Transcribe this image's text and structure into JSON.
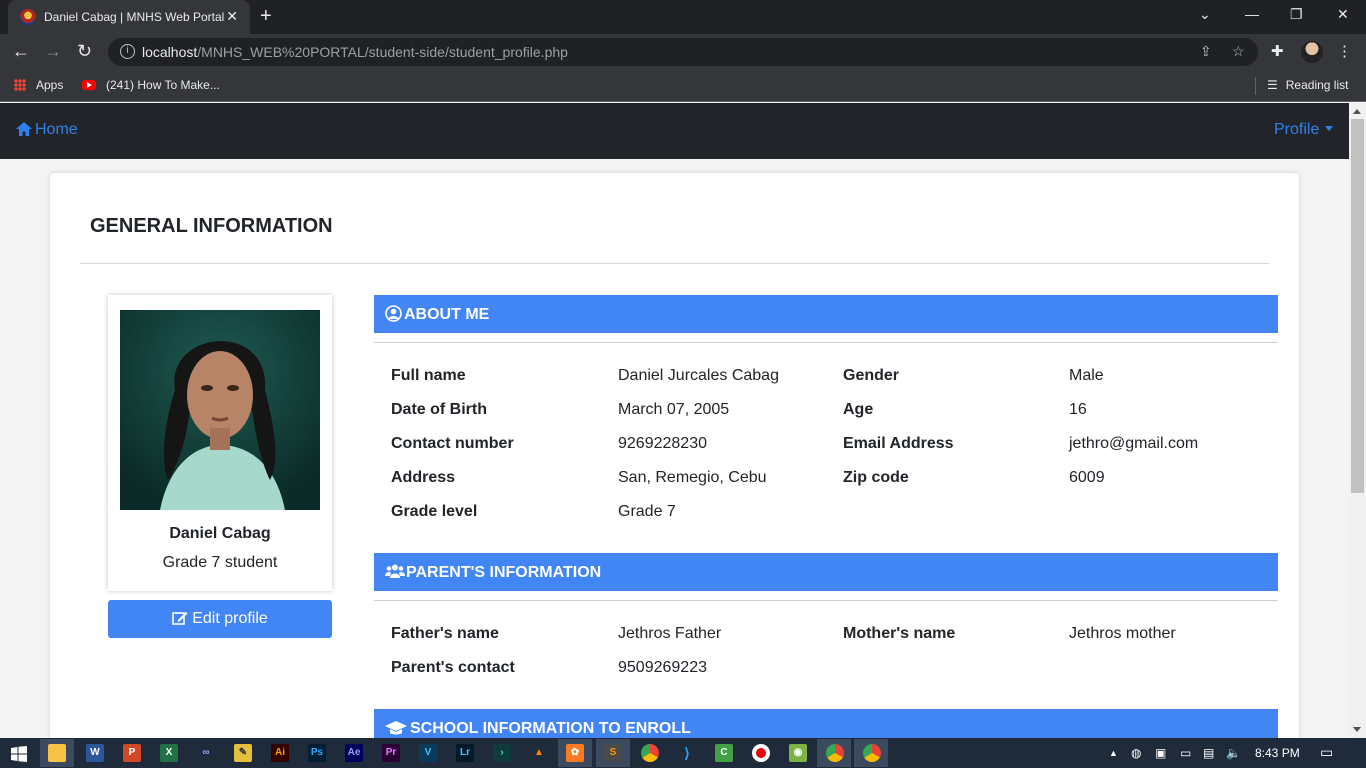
{
  "browser": {
    "tab_title": "Daniel Cabag | MNHS Web Portal",
    "url_host": "localhost",
    "url_path": "/MNHS_WEB%20PORTAL/student-side/student_profile.php",
    "bookmarks": [
      {
        "label": "Apps",
        "icon": "apps-grid-icon"
      },
      {
        "label": "(241) How To Make...",
        "icon": "youtube-icon"
      }
    ],
    "reading_list": "Reading list"
  },
  "nav": {
    "home_label": "Home",
    "profile_label": "Profile"
  },
  "page": {
    "title": "GENERAL INFORMATION"
  },
  "profile_card": {
    "name": "Daniel Cabag",
    "subtitle": "Grade 7 student",
    "edit_label": "Edit profile"
  },
  "about": {
    "heading": "ABOUT ME",
    "fields": [
      {
        "label": "Full name",
        "value": "Daniel Jurcales Cabag"
      },
      {
        "label": "Gender",
        "value": "Male"
      },
      {
        "label": "Date of Birth",
        "value": "March 07, 2005"
      },
      {
        "label": "Age",
        "value": "16"
      },
      {
        "label": "Contact number",
        "value": "9269228230"
      },
      {
        "label": "Email Address",
        "value": "jethro@gmail.com"
      },
      {
        "label": "Address",
        "value": "San, Remegio, Cebu"
      },
      {
        "label": "Zip code",
        "value": "6009"
      },
      {
        "label": "Grade level",
        "value": "Grade 7"
      }
    ]
  },
  "parents": {
    "heading": "PARENT'S INFORMATION",
    "fields": [
      {
        "label": "Father's name",
        "value": "Jethros Father"
      },
      {
        "label": "Mother's name",
        "value": "Jethros mother"
      },
      {
        "label": "Parent's contact",
        "value": "9509269223"
      }
    ]
  },
  "school": {
    "heading": "SCHOOL INFORMATION TO ENROLL"
  },
  "taskbar": {
    "time": "8:43 PM"
  },
  "colors": {
    "accent": "#4285f4",
    "nav_bg": "#212529",
    "link": "#2f80ed"
  }
}
